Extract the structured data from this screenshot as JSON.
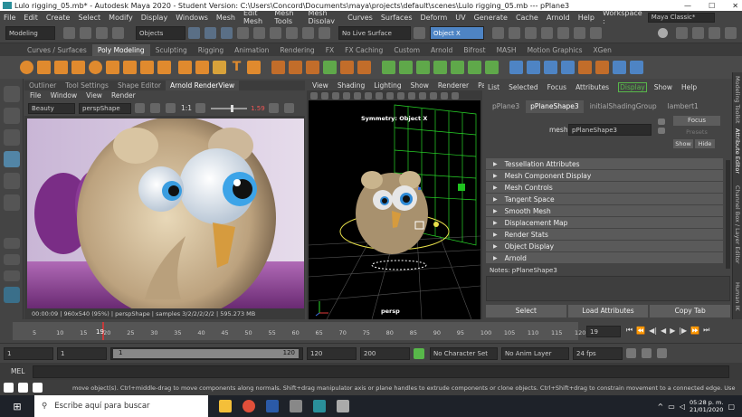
{
  "titlebar": {
    "title": "Lulo rigging_05.mb* - Autodesk Maya 2020 - Student Version: C:\\Users\\Concord\\Documents\\maya\\projects\\default\\scenes\\Lulo rigging_05.mb  ---  pPlane3",
    "minimize": "—",
    "maximize": "☐",
    "close": "✕"
  },
  "menubar": {
    "items": [
      "File",
      "Edit",
      "Create",
      "Select",
      "Modify",
      "Display",
      "Windows",
      "Mesh",
      "Edit Mesh",
      "Mesh Tools",
      "Mesh Display",
      "Curves",
      "Surfaces",
      "Deform",
      "UV",
      "Generate",
      "Cache",
      "Arnold",
      "Help"
    ],
    "workspace_label": "Workspace :",
    "workspace_value": "Maya Classic*"
  },
  "statusline": {
    "mode": "Modeling",
    "objects": "Objects",
    "live_surface": "No Live Surface",
    "symmetry": "Object X",
    "user_icon": "user-icon",
    "settings_icon": "gear-icon"
  },
  "shelf_tabs": {
    "items": [
      "Curves / Surfaces",
      "Poly Modeling",
      "Sculpting",
      "Rigging",
      "Animation",
      "Rendering",
      "FX",
      "FX Caching",
      "Custom",
      "Arnold",
      "Bifrost",
      "MASH",
      "Motion Graphics",
      "XGen"
    ],
    "active": "Poly Modeling"
  },
  "render_view": {
    "tabs": [
      "Outliner",
      "Tool Settings",
      "Shape Editor",
      "Arnold RenderView"
    ],
    "active_tab": "Arnold RenderView",
    "menu": [
      "File",
      "Window",
      "View",
      "Render"
    ],
    "aov": "Beauty",
    "camera": "perspShape",
    "ratio": "1:1",
    "exposure": "1.59",
    "status": "00:00:09 | 960x540 (95%) | perspShape | samples 3/2/2/2/2/2 | 595.273 MB"
  },
  "viewport": {
    "menu": [
      "View",
      "Shading",
      "Lighting",
      "Show",
      "Renderer",
      "Panels"
    ],
    "symmetry_label": "Symmetry: Object X",
    "camera_label": "persp"
  },
  "attribute_editor": {
    "menu": [
      "List",
      "Selected",
      "Focus",
      "Attributes",
      "Display",
      "Show",
      "Help"
    ],
    "highlighted_menu": "Display",
    "node_tabs": [
      "pPlane3",
      "pPlaneShape3",
      "initialShadingGroup",
      "lambert1"
    ],
    "active_node_tab": "pPlaneShape3",
    "mesh_label": "mesh:",
    "mesh_value": "pPlaneShape3",
    "focus_btn": "Focus",
    "presets_btn": "Presets",
    "show_btn": "Show",
    "hide_btn": "Hide",
    "sections": [
      "Tessellation Attributes",
      "Mesh Component Display",
      "Mesh Controls",
      "Tangent Space",
      "Smooth Mesh",
      "Displacement Map",
      "Render Stats",
      "Object Display",
      "Arnold"
    ],
    "notes": "Notes:  pPlaneShape3",
    "bottom_buttons": [
      "Select",
      "Load Attributes",
      "Copy Tab"
    ]
  },
  "side_strip": {
    "labels": [
      "Modeling Toolkit",
      "Attribute Editor",
      "Channel Box / Layer Editor",
      "Human IK"
    ]
  },
  "time_slider": {
    "ticks": [
      "5",
      "10",
      "15",
      "20",
      "25",
      "30",
      "35",
      "40",
      "45",
      "50",
      "55",
      "60",
      "65",
      "70",
      "75",
      "80",
      "85",
      "90",
      "95",
      "100",
      "105",
      "110",
      "115",
      "120"
    ],
    "current_frame": "19",
    "current_frame_field": "19",
    "current_frame_fraction": 0.158
  },
  "range_slider": {
    "start": "1",
    "anim_start": "1",
    "range_start": "1",
    "range_end": "120",
    "anim_end": "120",
    "end": "200",
    "character_set": "No Character Set",
    "anim_layer": "No Anim Layer",
    "fps": "24 fps"
  },
  "command_line": {
    "label": "MEL"
  },
  "help_line": {
    "text": "move object(s). Ctrl+middle-drag to move components along normals. Shift+drag manipulator axis or plane handles to extrude components or clone objects. Ctrl+Shift+drag to constrain movement to a connected edge. Use D or INSERT to change the pivot position and axis"
  },
  "taskbar": {
    "search_placeholder": "Escribe aquí para buscar",
    "time": "05:28 p. m.",
    "date": "21/01/2020"
  },
  "colors": {
    "accent": "#5285a6",
    "highlight_green": "#58b84a",
    "symmetry_blue": "#4e84c4",
    "timeline_red": "#c43b3b"
  }
}
